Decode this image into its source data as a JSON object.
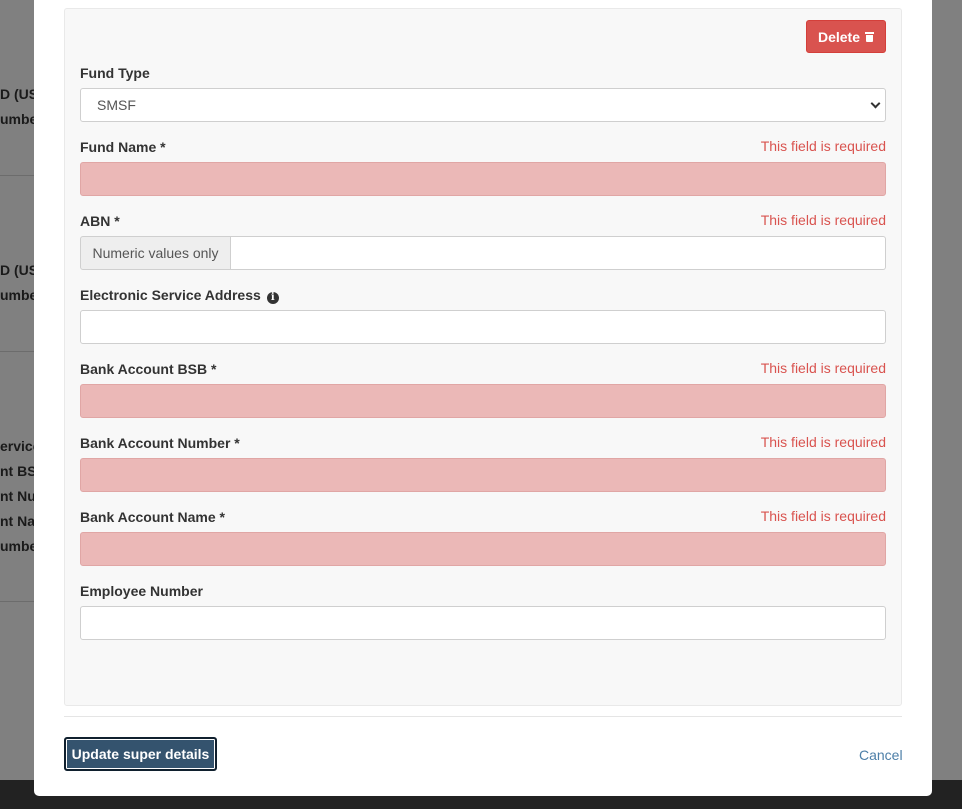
{
  "background": {
    "fragments": [
      "D (US",
      "umber",
      "D (US",
      "umber",
      "ervice",
      "nt BSB",
      "nt Num",
      "nt Nar",
      "umber"
    ]
  },
  "modal": {
    "delete_label": "Delete",
    "fields": {
      "fund_type": {
        "label": "Fund Type",
        "value": "SMSF"
      },
      "fund_name": {
        "label": "Fund Name *",
        "error": "This field is required",
        "value": ""
      },
      "abn": {
        "label": "ABN *",
        "error": "This field is required",
        "addon": "Numeric values only",
        "value": ""
      },
      "esa": {
        "label": "Electronic Service Address",
        "value": ""
      },
      "bsb": {
        "label": "Bank Account BSB *",
        "error": "This field is required",
        "value": ""
      },
      "account_number": {
        "label": "Bank Account Number *",
        "error": "This field is required",
        "value": ""
      },
      "account_name": {
        "label": "Bank Account Name *",
        "error": "This field is required",
        "value": ""
      },
      "employee_number": {
        "label": "Employee Number",
        "value": ""
      }
    },
    "footer": {
      "update_label": "Update super details",
      "cancel_label": "Cancel"
    }
  },
  "colors": {
    "danger": "#d9534f",
    "invalid_bg": "#ebb8b7",
    "primary": "#34536e",
    "link": "#4d7fa8"
  },
  "icons": [
    "trash-icon",
    "info-icon",
    "chevron-down-icon"
  ]
}
